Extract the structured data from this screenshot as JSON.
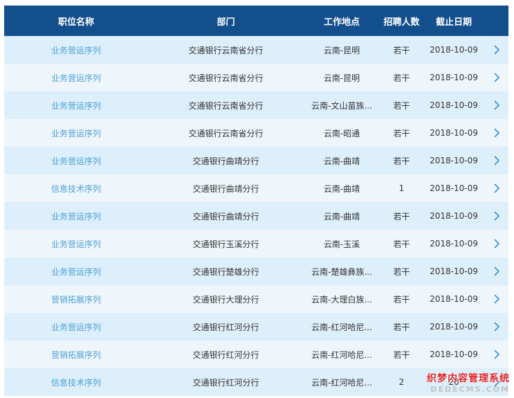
{
  "headers": [
    "职位名称",
    "部门",
    "工作地点",
    "招聘人数",
    "截止日期"
  ],
  "rows": [
    {
      "position": "业务营运序列",
      "department": "交通银行云南省分行",
      "location": "云南-昆明",
      "count": "若干",
      "deadline": "2018-10-09"
    },
    {
      "position": "业务营运序列",
      "department": "交通银行云南省分行",
      "location": "云南-昆明",
      "count": "若干",
      "deadline": "2018-10-09"
    },
    {
      "position": "业务营运序列",
      "department": "交通银行云南省分行",
      "location": "云南-文山苗族...",
      "count": "若干",
      "deadline": "2018-10-09"
    },
    {
      "position": "业务营运序列",
      "department": "交通银行云南省分行",
      "location": "云南-昭通",
      "count": "若干",
      "deadline": "2018-10-09"
    },
    {
      "position": "业务营运序列",
      "department": "交通银行曲靖分行",
      "location": "云南-曲靖",
      "count": "若干",
      "deadline": "2018-10-09"
    },
    {
      "position": "信息技术序列",
      "department": "交通银行曲靖分行",
      "location": "云南-曲靖",
      "count": "1",
      "deadline": "2018-10-09"
    },
    {
      "position": "业务营运序列",
      "department": "交通银行曲靖分行",
      "location": "云南-曲靖",
      "count": "若干",
      "deadline": "2018-10-09"
    },
    {
      "position": "业务营运序列",
      "department": "交通银行玉溪分行",
      "location": "云南-玉溪",
      "count": "若干",
      "deadline": "2018-10-09"
    },
    {
      "position": "业务营运序列",
      "department": "交通银行楚雄分行",
      "location": "云南-楚雄彝族...",
      "count": "若干",
      "deadline": "2018-10-09"
    },
    {
      "position": "营销拓展序列",
      "department": "交通银行大理分行",
      "location": "云南-大理白族...",
      "count": "若干",
      "deadline": "2018-10-09"
    },
    {
      "position": "业务营运序列",
      "department": "交通银行红河分行",
      "location": "云南-红河哈尼...",
      "count": "若干",
      "deadline": "2018-10-09"
    },
    {
      "position": "营销拓展序列",
      "department": "交通银行红河分行",
      "location": "云南-红河哈尼...",
      "count": "若干",
      "deadline": "2018-10-09"
    },
    {
      "position": "信息技术序列",
      "department": "交通银行红河分行",
      "location": "云南-红河哈尼...",
      "count": "2",
      "deadline": "20"
    }
  ],
  "row_icon": "chevron-right-icon",
  "watermark": {
    "line1": "织梦内容管理系统",
    "line2": "DEDECMS.COM"
  },
  "colors": {
    "header_bg": "#134f8c",
    "row_odd": "#ddeffa",
    "row_even": "#eef6fb",
    "link": "#4d9fd6",
    "chevron": "#3a8fd0"
  }
}
